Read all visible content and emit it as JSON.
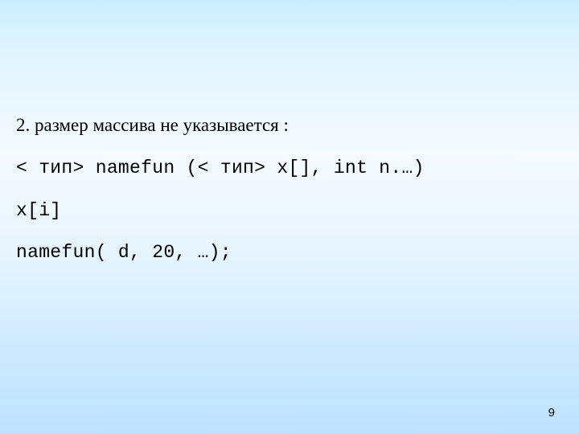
{
  "lines": {
    "l1": "2. размер массива не указывается :",
    "l2": "< тип> namefun (< тип> x[], int n.…)",
    "l3": "x[i]",
    "l4": "namefun( d, 20, …);"
  },
  "page_number": "9"
}
